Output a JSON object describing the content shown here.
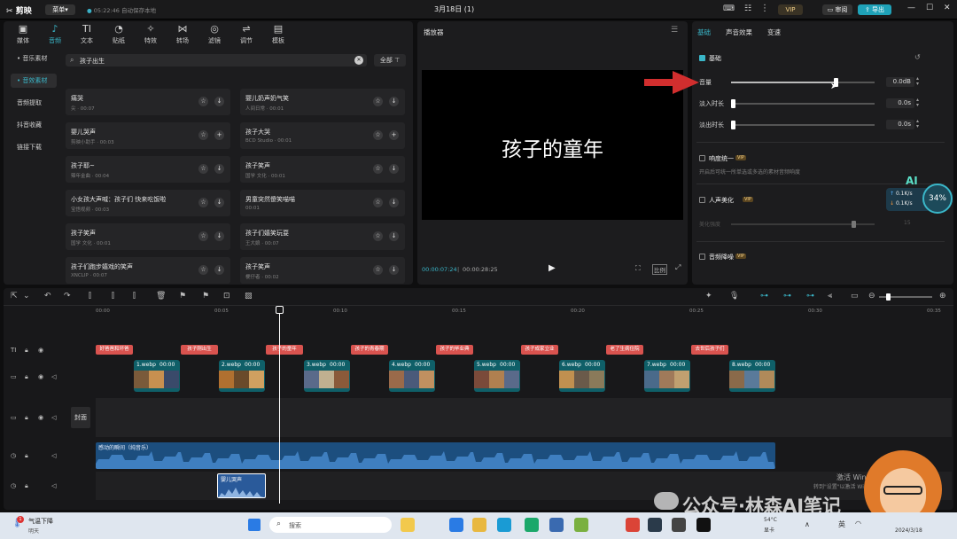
{
  "app": {
    "logo_text": "剪映",
    "menu_label": "菜单",
    "autosave": "05:22:46 自动保存本地",
    "title": "3月18日 (1)",
    "vip_label": "VIP",
    "review_label": "审阅",
    "export_label": "导出"
  },
  "media_tabs": [
    {
      "label": "媒体",
      "icon": "media-icon",
      "glyph": "▣"
    },
    {
      "label": "音频",
      "icon": "audio-icon",
      "glyph": "♪"
    },
    {
      "label": "文本",
      "icon": "text-icon",
      "glyph": "TI"
    },
    {
      "label": "贴纸",
      "icon": "sticker-icon",
      "glyph": "◔"
    },
    {
      "label": "特效",
      "icon": "effects-icon",
      "glyph": "✧"
    },
    {
      "label": "转场",
      "icon": "transition-icon",
      "glyph": "⋈"
    },
    {
      "label": "滤镜",
      "icon": "filter-icon",
      "glyph": "◎"
    },
    {
      "label": "调节",
      "icon": "adjust-icon",
      "glyph": "⇌"
    },
    {
      "label": "模板",
      "icon": "template-icon",
      "glyph": "▤"
    }
  ],
  "sidebar": {
    "items": [
      "• 音乐素材",
      "• 音效素材",
      "音频提取",
      "抖音收藏",
      "链接下载"
    ]
  },
  "search": {
    "value": "孩子出生",
    "filter_label": "全部"
  },
  "sound_cards": [
    {
      "title": "痛哭",
      "sub": "尖 · 00:07"
    },
    {
      "title": "婴儿奶声奶气笑",
      "sub": "人间日常 · 00:01"
    },
    {
      "title": "婴儿哭声",
      "sub": "剪映小助手 · 00:03"
    },
    {
      "title": "孩子大哭",
      "sub": "BCD Studio · 00:01"
    },
    {
      "title": "孩子耶~",
      "sub": "辣年金曲 · 00:04"
    },
    {
      "title": "孩子笑声",
      "sub": "国学 文化 · 00:01"
    },
    {
      "title": "小女孩大声喊：孩子们 快来吃饭啦",
      "sub": "宝悟视频 · 00:03"
    },
    {
      "title": "男童突然傻笑喵喵",
      "sub": "00:01"
    },
    {
      "title": "孩子笑声",
      "sub": "国学 文化 · 00:01"
    },
    {
      "title": "孩子们嬉笑玩耍",
      "sub": "王大娘 · 00:07"
    },
    {
      "title": "孩子们跑步嬉戏的笑声",
      "sub": "XNCLIP · 00:07"
    },
    {
      "title": "孩子笑声",
      "sub": "梗仔者 · 00:02"
    }
  ],
  "player": {
    "label": "播放器",
    "caption": "孩子的童年",
    "current_time": "00:00:07:24",
    "total_time": "00:00:28:25",
    "ratio_label": "比例"
  },
  "inspector": {
    "tabs": [
      "基础",
      "声音效果",
      "变速"
    ],
    "section_basic": "基础",
    "volume_label": "音量",
    "volume_value": "0.0dB",
    "fade_in_label": "淡入时长",
    "fade_in_value": "0.0s",
    "fade_out_label": "淡出时长",
    "fade_out_value": "0.0s",
    "loudness_label": "响度统一",
    "loudness_desc": "开启后可统一所单选或多选的素材音频响度",
    "voice_label": "人声美化",
    "voice_strength": "美化强度",
    "voice_value": "15",
    "denoise_label": "音频降噪",
    "vip_badge": "VIP"
  },
  "net_widget": {
    "up": "0.1K/s",
    "down": "0.1K/s",
    "percent": "34%",
    "ai": "AI"
  },
  "ruler": [
    "00:00",
    "00:05",
    "00:10",
    "00:15",
    "00:20",
    "00:25",
    "00:30",
    "00:35"
  ],
  "text_tags": [
    "好爸爸和坏爸",
    "孩子刚出生",
    "孩子的童年",
    "孩子的青春期",
    "孩子的毕业典",
    "孩子成家立业",
    "老了生病住院",
    "去世后孩子们"
  ],
  "clips": [
    "1.webp",
    "2.webp",
    "3.webp",
    "4.webp",
    "5.webp",
    "6.webp",
    "7.webp",
    "8.webp"
  ],
  "clip_dur": "00:00",
  "cover_label": "封面",
  "audio_track": {
    "music": "感动的瞬间（纯音乐）",
    "sfx": "婴儿哭声"
  },
  "watermark": {
    "text": "公众号·林森AI笔记",
    "activate": "激活 Windows",
    "activate_sub": "转到\"设置\"以激活 Windows。"
  },
  "taskbar": {
    "weather": "气温下降",
    "weather_sub": "明天",
    "search_placeholder": "搜索",
    "temp": "54°C",
    "temp_sub": "显卡",
    "lang": "英",
    "time": "2024/3/18"
  }
}
